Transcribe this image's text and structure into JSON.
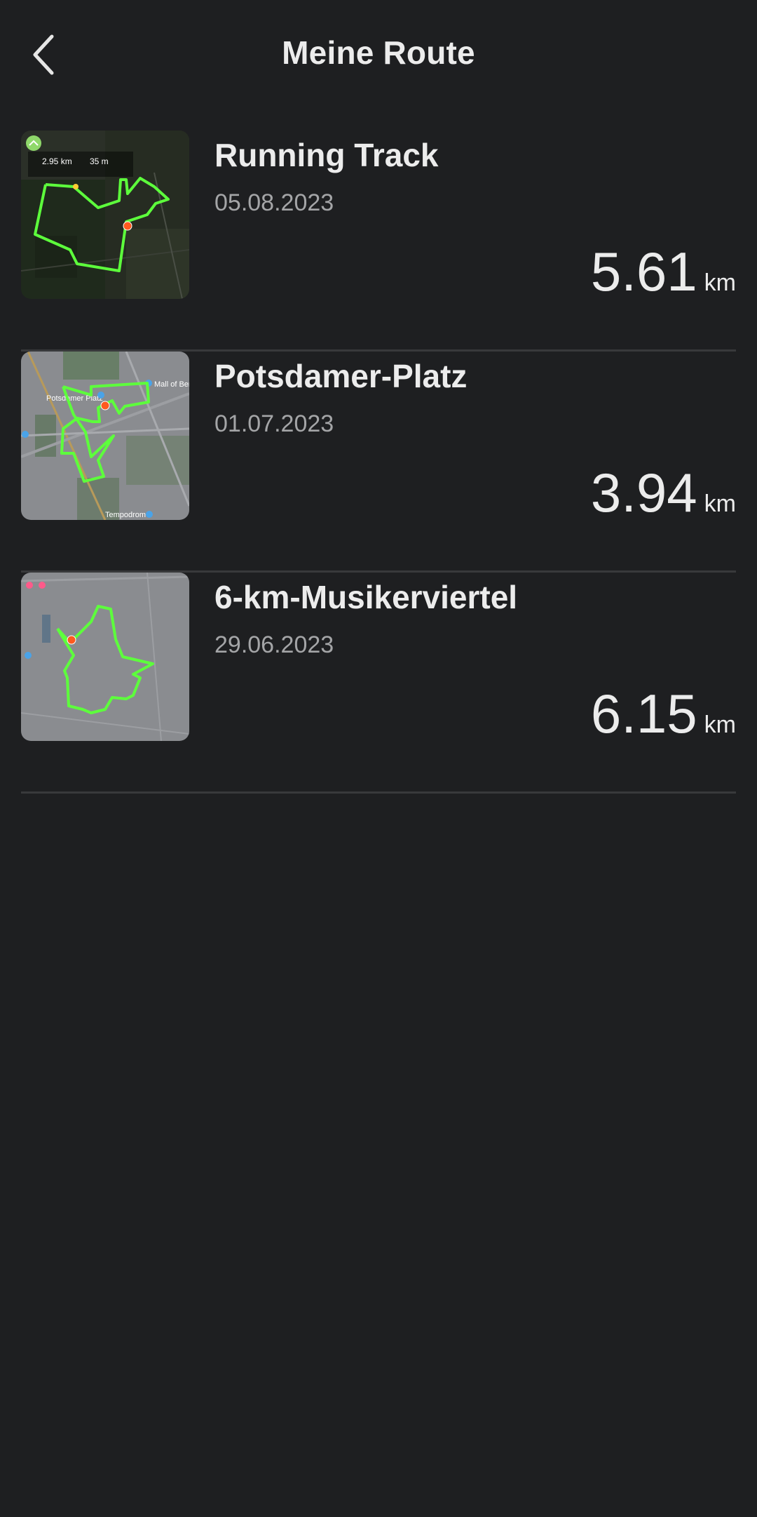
{
  "header": {
    "title": "Meine Route"
  },
  "routes": [
    {
      "name": "Running Track",
      "date": "05.08.2023",
      "distance": "5.61",
      "unit": "km",
      "map_stats": {
        "distance": "2.95 km",
        "elevation": "35 m"
      }
    },
    {
      "name": "Potsdamer-Platz",
      "date": "01.07.2023",
      "distance": "3.94",
      "unit": "km",
      "map_labels": {
        "place": "Potsdamer Platz",
        "mall": "Mall of Berlin",
        "tempodrom": "Tempodrom"
      }
    },
    {
      "name": "6-km-Musikerviertel",
      "date": "29.06.2023",
      "distance": "6.15",
      "unit": "km"
    }
  ],
  "colors": {
    "background": "#1e1f21",
    "route_line": "#5dff3c",
    "marker": "#ff5a1f",
    "divider": "#38393b"
  }
}
